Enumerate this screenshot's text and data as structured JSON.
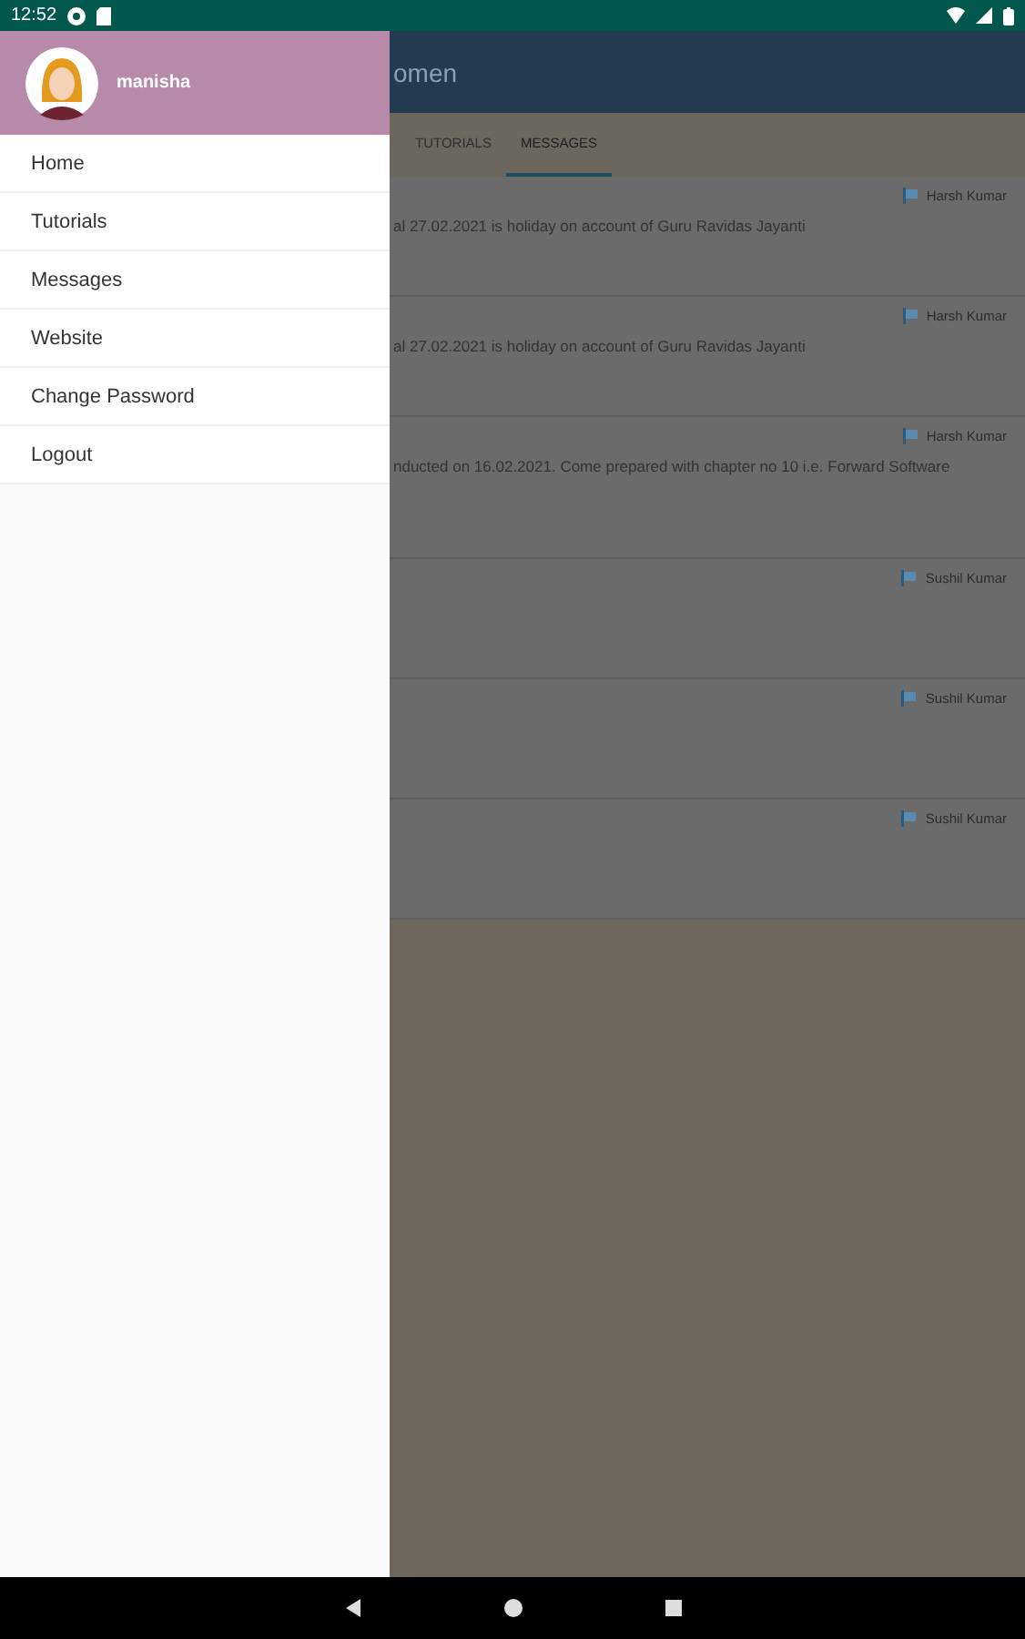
{
  "status_bar": {
    "time": "12:52"
  },
  "drawer": {
    "user": {
      "name": "manisha"
    },
    "items": [
      {
        "label": "Home"
      },
      {
        "label": "Tutorials"
      },
      {
        "label": "Messages"
      },
      {
        "label": "Website"
      },
      {
        "label": "Change Password"
      },
      {
        "label": "Logout"
      }
    ]
  },
  "app_bar": {
    "title": "omen"
  },
  "tabs": [
    {
      "label": "TUTORIALS",
      "selected": false
    },
    {
      "label": "MESSAGES",
      "selected": true
    }
  ],
  "messages": [
    {
      "sender": "Harsh Kumar",
      "text": "al 27.02.2021 is holiday on account of Guru Ravidas Jayanti"
    },
    {
      "sender": "Harsh Kumar",
      "text": "al 27.02.2021 is holiday on account of Guru Ravidas Jayanti"
    },
    {
      "sender": "Harsh Kumar",
      "text": "nducted on 16.02.2021. Come prepared with chapter no 10 i.e. Forward Software"
    },
    {
      "sender": "Sushil Kumar"
    },
    {
      "sender": "Sushil Kumar"
    },
    {
      "sender": "Sushil Kumar"
    }
  ]
}
